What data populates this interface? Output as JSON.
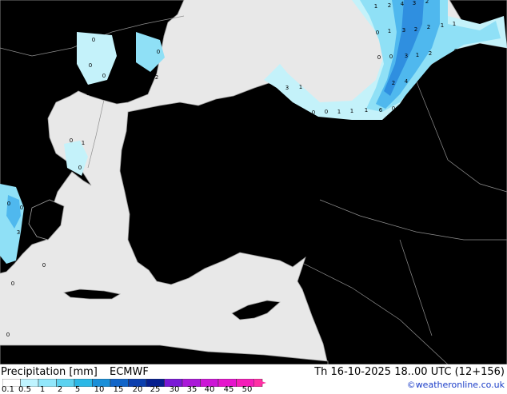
{
  "legend": {
    "title": "Precipitation [mm]",
    "model": "ECMWF",
    "levels": [
      "0.1",
      "0.5",
      "1",
      "2",
      "5",
      "10",
      "15",
      "20",
      "25",
      "30",
      "35",
      "40",
      "45",
      "50"
    ],
    "colors": [
      "#ffffff",
      "#bff4ff",
      "#92e7fb",
      "#5cd2f0",
      "#2cb8e6",
      "#1a8fd8",
      "#1165c8",
      "#0b3fae",
      "#061f8e",
      "#7a1ad6",
      "#aa19d8",
      "#cc15d6",
      "#e514cc",
      "#f51db8",
      "#ff31a4"
    ]
  },
  "run": "Th 16-10-2025 18..00 UTC (12+156)",
  "credit": "©weatheronline.co.uk",
  "map": {
    "colors": {
      "sea": "#e8e8e8",
      "land": "#bff49a",
      "coast": "#a0a0a0",
      "border": "#909090",
      "rain_light": "#c4f2fa",
      "rain_mid": "#8fe0f6",
      "rain_heavy": "#4fb8ee",
      "rain_max": "#2f8fe0"
    },
    "labels": [
      {
        "t": "1"
      },
      {
        "t": "2"
      },
      {
        "t": "4"
      },
      {
        "t": "3"
      },
      {
        "t": "2"
      },
      {
        "t": "0"
      },
      {
        "t": "1"
      },
      {
        "t": "3"
      },
      {
        "t": "2"
      },
      {
        "t": "2"
      },
      {
        "t": "1"
      },
      {
        "t": "1"
      },
      {
        "t": "0"
      },
      {
        "t": "0"
      },
      {
        "t": "3"
      },
      {
        "t": "1"
      },
      {
        "t": "2"
      },
      {
        "t": "0"
      },
      {
        "t": "2"
      },
      {
        "t": "4"
      },
      {
        "t": "6"
      },
      {
        "t": "3"
      },
      {
        "t": "1"
      },
      {
        "t": "0"
      },
      {
        "t": "0"
      },
      {
        "t": "0"
      },
      {
        "t": "0"
      },
      {
        "t": "1"
      },
      {
        "t": "1"
      },
      {
        "t": "1"
      },
      {
        "t": "0"
      },
      {
        "t": "0"
      },
      {
        "t": "0"
      },
      {
        "t": "0"
      },
      {
        "t": "0"
      },
      {
        "t": "1"
      },
      {
        "t": "0"
      },
      {
        "t": "2"
      },
      {
        "t": "0"
      },
      {
        "t": "1"
      },
      {
        "t": "0"
      },
      {
        "t": "1"
      },
      {
        "t": "0"
      },
      {
        "t": "1"
      },
      {
        "t": "0"
      },
      {
        "t": "3"
      },
      {
        "t": "2"
      },
      {
        "t": "0"
      },
      {
        "t": "0"
      },
      {
        "t": "0"
      },
      {
        "t": "0"
      }
    ]
  }
}
